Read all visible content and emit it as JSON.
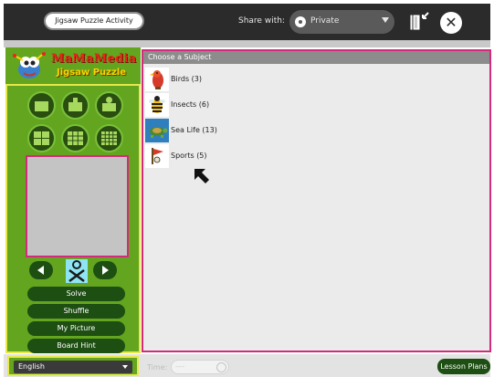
{
  "toolbar": {
    "activity_name": "Jigsaw Puzzle Activity",
    "share_label": "Share with:",
    "share_value": "Private",
    "keep_icon": "keep-journal-icon",
    "stop_icon": "stop-x-icon"
  },
  "logo": {
    "title": "MaMaMedia",
    "subtitle": "Jigsaw Puzzle"
  },
  "controls": {
    "shape_icons": [
      "square-piece-icon",
      "tab-top-piece-icon",
      "knob-top-piece-icon"
    ],
    "grid_icons": [
      "grid-2x2-icon",
      "grid-3x3-icon",
      "grid-4x4-icon"
    ],
    "prev_icon": "arrow-left-icon",
    "next_icon": "arrow-right-icon",
    "xo_icon": "xo-person-icon",
    "buttons": [
      "Solve",
      "Shuffle",
      "My Picture",
      "Board Hint"
    ]
  },
  "main": {
    "header": "Choose a Subject",
    "subjects": [
      {
        "label": "Birds (3)",
        "icon": "bird-icon"
      },
      {
        "label": "Insects (6)",
        "icon": "bee-icon"
      },
      {
        "label": "Sea Life (13)",
        "icon": "turtle-icon"
      },
      {
        "label": "Sports (5)",
        "icon": "flag-icon"
      }
    ]
  },
  "bottom": {
    "language": "English",
    "time_label": "Time:",
    "time_value": "----",
    "lesson_plans": "Lesson Plans"
  },
  "colors": {
    "toolbar_bg": "#2b2b2b",
    "panel_green": "#63a51f",
    "button_dark_green": "#1d4e12",
    "accent_pink": "#d32b7b",
    "accent_yellow": "#e7e84b",
    "logo_red": "#e8261a",
    "logo_yellow": "#ffd400"
  }
}
